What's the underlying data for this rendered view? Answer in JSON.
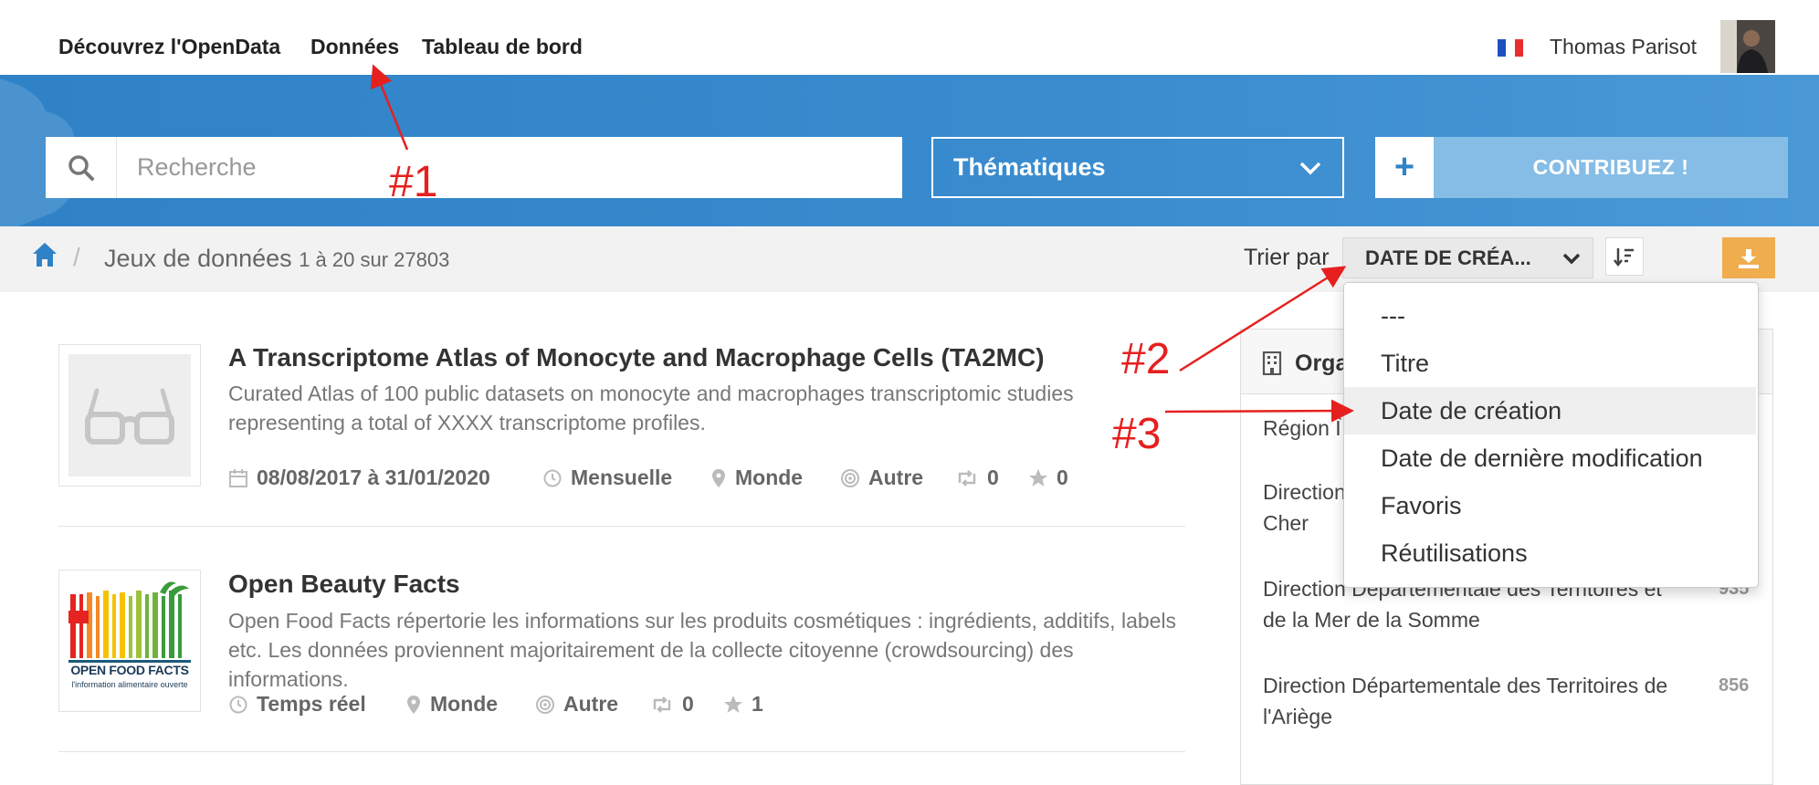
{
  "nav": {
    "links": [
      "Découvrez l'OpenData",
      "Données",
      "Tableau de bord"
    ],
    "user_name": "Thomas Parisot"
  },
  "hero": {
    "search_placeholder": "Recherche",
    "themes_label": "Thématiques",
    "contribute_label": "CONTRIBUEZ !"
  },
  "breadcrumb": {
    "title": "Jeux de données",
    "count": "1 à 20 sur 27803"
  },
  "sort": {
    "label": "Trier par",
    "selected": "DATE DE CRÉA...",
    "options": [
      "---",
      "Titre",
      "Date de création",
      "Date de dernière modification",
      "Favoris",
      "Réutilisations"
    ],
    "highlighted_index": 2
  },
  "datasets": [
    {
      "title": "A Transcriptome Atlas of Monocyte and Macrophage Cells (TA2MC)",
      "description": "Curated Atlas of 100 public datasets on monocyte and macrophages transcriptomic studies representing a total of XXXX transcriptome profiles.",
      "dates": "08/08/2017 à 31/01/2020",
      "frequency": "Mensuelle",
      "zone": "Monde",
      "granularity": "Autre",
      "reuses": "0",
      "favorites": "0"
    },
    {
      "title": "Open Beauty Facts",
      "description": "Open Food Facts répertorie les informations sur les produits cosmétiques : ingrédients, additifs, labels etc. Les données proviennent majoritairement de la collecte citoyenne (crowdsourcing) des informations.",
      "frequency": "Temps réel",
      "zone": "Monde",
      "granularity": "Autre",
      "reuses": "0",
      "favorites": "1",
      "logo_text": "OPEN FOOD FACTS",
      "logo_subtext": "l'information alimentaire ouverte"
    }
  ],
  "sidebar": {
    "title": "Orga",
    "items": [
      {
        "label": "Région Î",
        "count": ""
      },
      {
        "label_line1": "Direction",
        "label_line2": "Cher",
        "count": ""
      },
      {
        "label_line1": "Direction Départementale des Territoires et",
        "label_line2": "de la Mer de la Somme",
        "count": "935"
      },
      {
        "label_line1": "Direction Départementale des Territoires de",
        "label_line2": "l'Ariège",
        "count": "856"
      }
    ]
  },
  "annotations": [
    "#1",
    "#2",
    "#3"
  ],
  "colors": {
    "hero_blue": "#2f82c6",
    "contribute_bg": "#86bde6",
    "download_orange": "#f0ad4e",
    "annotation_red": "#e5201f"
  }
}
